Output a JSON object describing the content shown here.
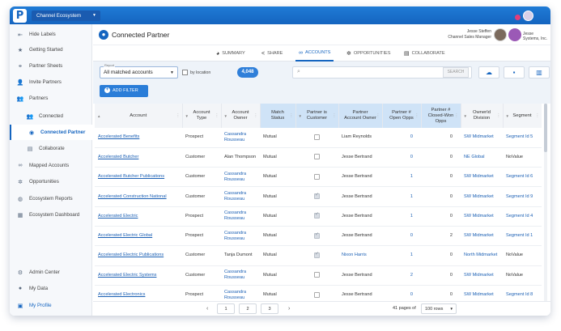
{
  "app": {
    "logo_letter": "P",
    "ecosystem_select": "Channel Ecosystem",
    "accent_color": "#1565c0"
  },
  "sidebar": {
    "items": [
      {
        "label": "Hide Labels",
        "icon": "collapse-icon"
      },
      {
        "label": "Getting Started",
        "icon": "star-icon"
      },
      {
        "label": "Partner Sheets",
        "icon": "handshake-icon"
      },
      {
        "label": "Invite Partners",
        "icon": "invite-user-icon"
      },
      {
        "label": "Partners",
        "icon": "users-icon"
      },
      {
        "label": "Connected",
        "icon": "people-icon"
      },
      {
        "label": "Connected Partner",
        "icon": "user-circle-icon"
      },
      {
        "label": "Collaborate",
        "icon": "chat-icon"
      },
      {
        "label": "Mapped Accounts",
        "icon": "link-icon"
      },
      {
        "label": "Opportunities",
        "icon": "network-icon"
      },
      {
        "label": "Ecosystem Reports",
        "icon": "globe-icon"
      },
      {
        "label": "Ecosystem Dashboard",
        "icon": "dashboard-icon"
      },
      {
        "label": "Admin Center",
        "icon": "gear-icon"
      },
      {
        "label": "My Data",
        "icon": "person-icon"
      },
      {
        "label": "My Profile",
        "icon": "profile-icon"
      }
    ]
  },
  "header": {
    "title": "Connected Partner",
    "user_name": "Jesse Steffen",
    "user_role": "Channel Sales Manager",
    "partner_company": "Jesse Systems, Inc."
  },
  "tabs": [
    {
      "label": "SUMMARY",
      "icon": "pie-chart-icon"
    },
    {
      "label": "SHARE",
      "icon": "share-icon"
    },
    {
      "label": "ACCOUNTS",
      "icon": "infinity-icon"
    },
    {
      "label": "OPPORTUNITIES",
      "icon": "network-icon"
    },
    {
      "label": "COLLABORATE",
      "icon": "chat-icon"
    }
  ],
  "filters": {
    "report_label": "Report",
    "report_value": "All matched accounts",
    "by_location_label": "by location",
    "match_count": "4,048",
    "search_placeholder": "",
    "search_button": "SEARCH",
    "add_filter": "ADD FILTER",
    "tools": [
      "upload-cloud-icon",
      "save-icon",
      "columns-icon"
    ]
  },
  "table": {
    "columns": [
      "Account",
      "Account Type",
      "Account Owner",
      "Match Status",
      "Partner is Customer",
      "Partner Account Owner",
      "Partner # Open Opps",
      "Partner # Closed-Won Opps",
      "OwnerId Division",
      "Segment"
    ],
    "rows": [
      {
        "account": "Accelerated Benefits",
        "type": "Prospect",
        "owner": "Cassandra Rousseau",
        "match": "Mutual",
        "is_customer": false,
        "partner_owner": "Liam Reynolds",
        "open": "0",
        "closed": "0",
        "division": "SW Midmarket",
        "segment": "Segment Id 5"
      },
      {
        "account": "Accelerated Butcher",
        "type": "Customer",
        "owner": "Alan Thompson",
        "match": "Mutual",
        "is_customer": false,
        "partner_owner": "Jesse Bertrand",
        "open": "0",
        "closed": "0",
        "division": "NE Global",
        "segment": "NoValue"
      },
      {
        "account": "Accelerated Butcher Publications",
        "type": "Customer",
        "owner": "Cassandra Rousseau",
        "match": "Mutual",
        "is_customer": false,
        "partner_owner": "Jesse Bertrand",
        "open": "1",
        "closed": "0",
        "division": "SW Midmarket",
        "segment": "Segment Id 6"
      },
      {
        "account": "Accelerated Construction National",
        "type": "Customer",
        "owner": "Cassandra Rousseau",
        "match": "Mutual",
        "is_customer": true,
        "partner_owner": "Jesse Bertrand",
        "open": "1",
        "closed": "0",
        "division": "SW Midmarket",
        "segment": "Segment Id 9"
      },
      {
        "account": "Accelerated Electric",
        "type": "Prospect",
        "owner": "Cassandra Rousseau",
        "match": "Mutual",
        "is_customer": true,
        "partner_owner": "Jesse Bertrand",
        "open": "1",
        "closed": "0",
        "division": "SW Midmarket",
        "segment": "Segment Id 4"
      },
      {
        "account": "Accelerated Electric Global",
        "type": "Prospect",
        "owner": "Cassandra Rousseau",
        "match": "Mutual",
        "is_customer": true,
        "partner_owner": "Jesse Bertrand",
        "open": "0",
        "closed": "2",
        "division": "SW Midmarket",
        "segment": "Segment Id 1"
      },
      {
        "account": "Accelerated Electric Publications",
        "type": "Customer",
        "owner": "Tanja Dumont",
        "match": "Mutual",
        "is_customer": true,
        "partner_owner": "Nixon Harris",
        "open": "1",
        "closed": "0",
        "division": "North Midmarket",
        "segment": "NoValue"
      },
      {
        "account": "Accelerated Electric Systems",
        "type": "Customer",
        "owner": "Cassandra Rousseau",
        "match": "Mutual",
        "is_customer": false,
        "partner_owner": "Jesse Bertrand",
        "open": "2",
        "closed": "0",
        "division": "SW Midmarket",
        "segment": "NoValue"
      },
      {
        "account": "Accelerated Electronics",
        "type": "Prospect",
        "owner": "Cassandra Rousseau",
        "match": "Mutual",
        "is_customer": false,
        "partner_owner": "Jesse Bertrand",
        "open": "0",
        "closed": "0",
        "division": "SW Midmarket",
        "segment": "Segment Id 8"
      }
    ]
  },
  "pagination": {
    "pages": [
      "1",
      "2",
      "3"
    ],
    "info": "41 pages of",
    "rows_per_page": "100 rows"
  }
}
